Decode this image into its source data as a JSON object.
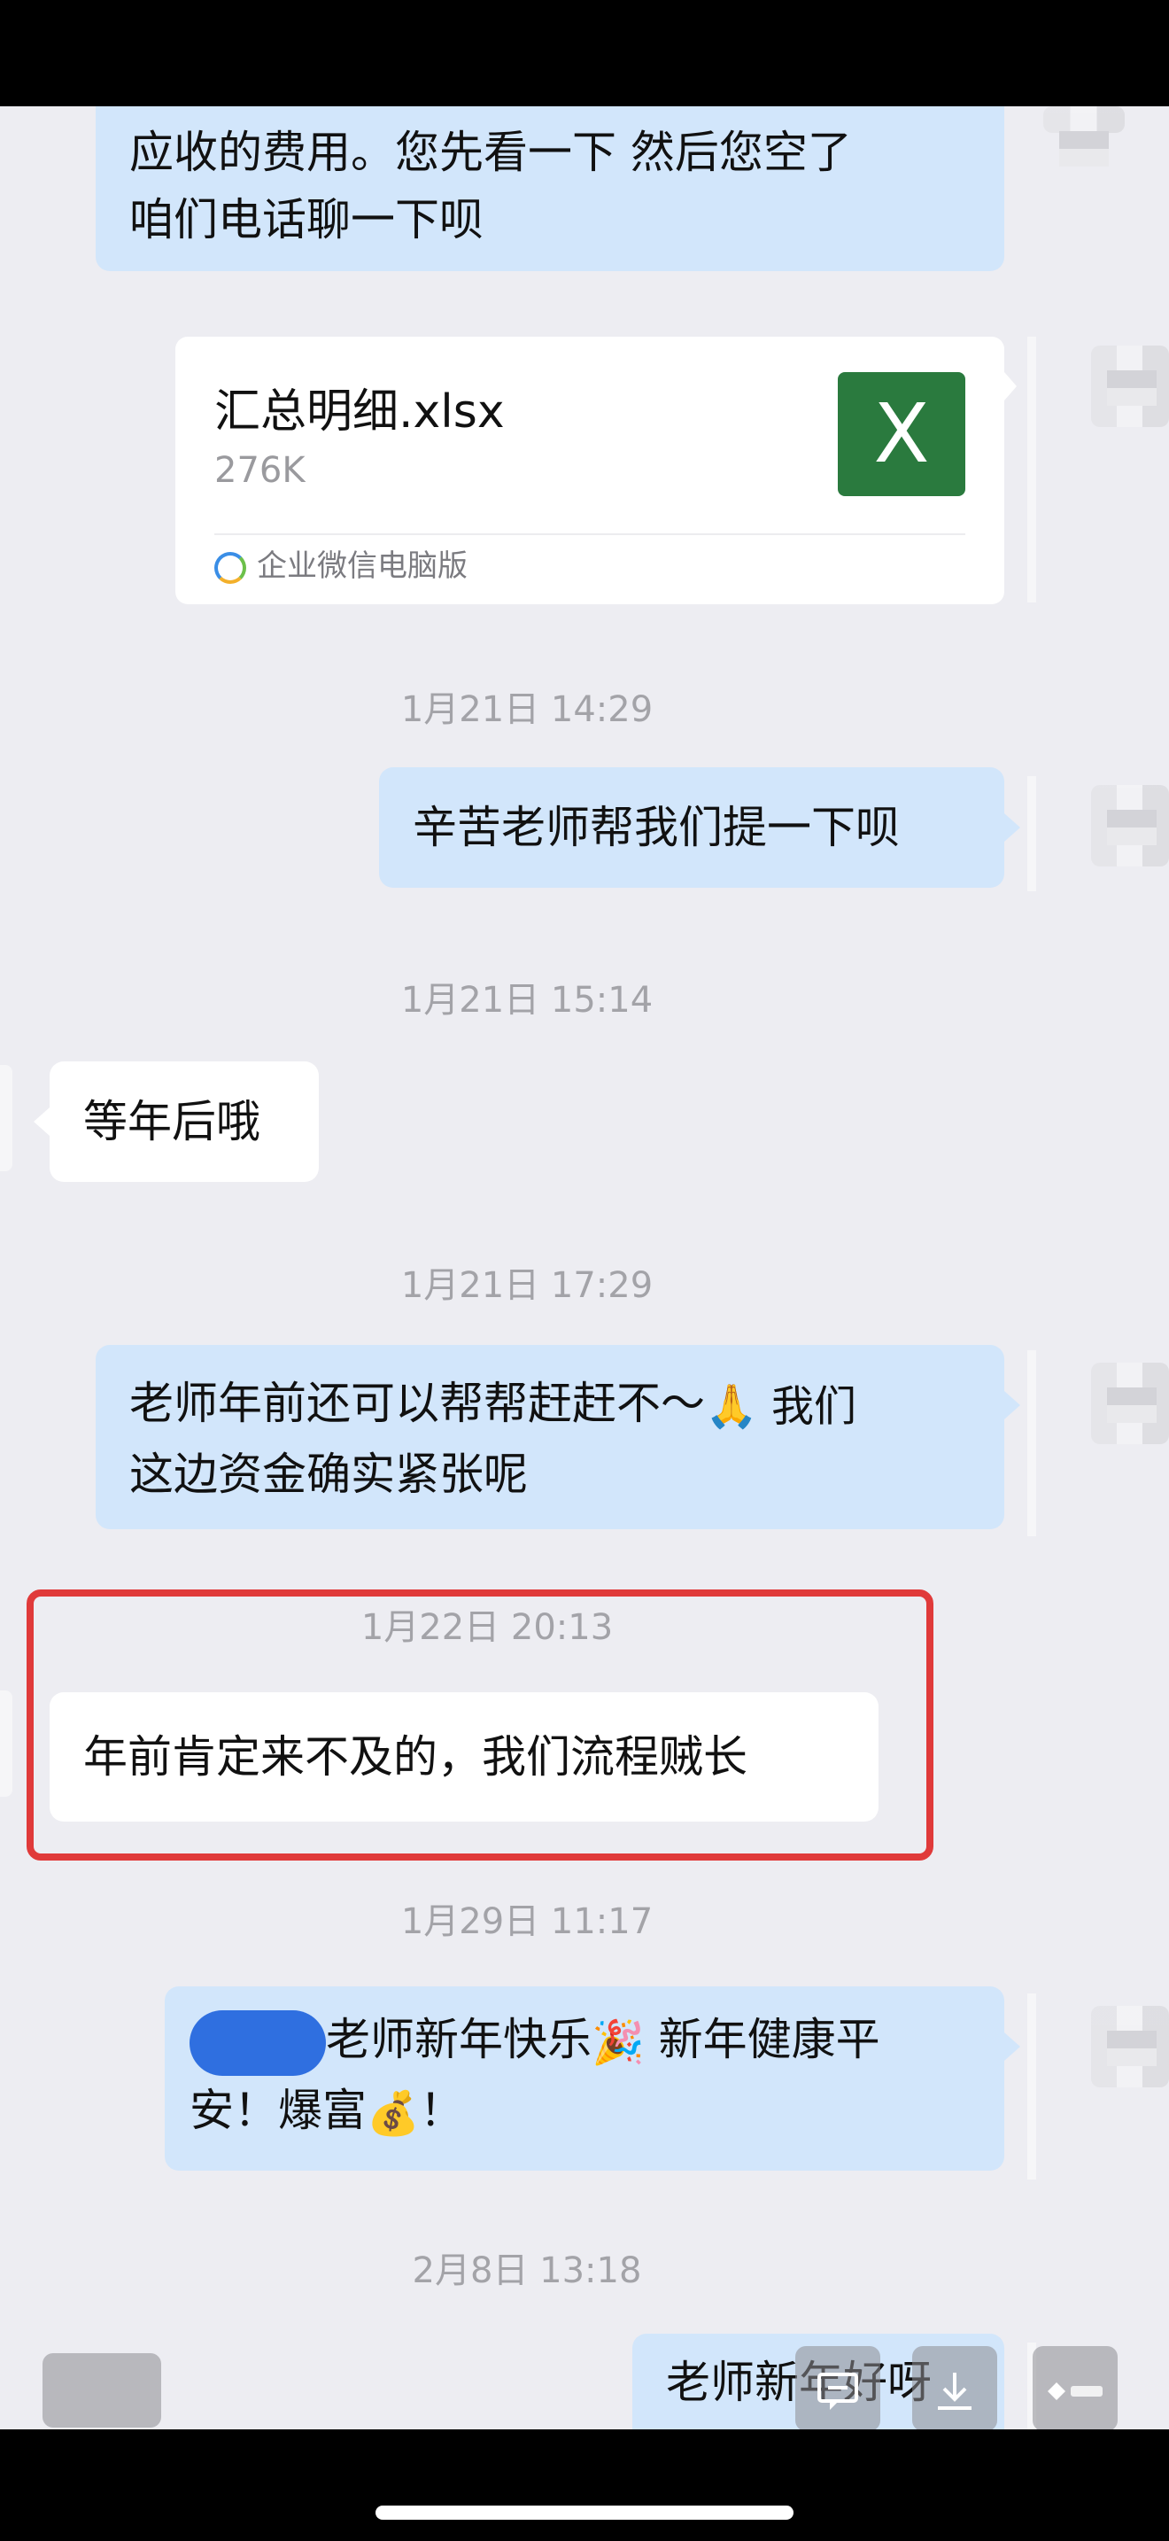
{
  "chat": {
    "messages": [
      {
        "kind": "out",
        "lines": [
          "应收的费用。您先看一下 然后您空了",
          "咱们电话聊一下呗"
        ]
      },
      {
        "kind": "file",
        "file_name": "汇总明细.xlsx",
        "file_size": "276K",
        "source": "企业微信电脑版",
        "icon_letter": "X"
      },
      {
        "kind": "time",
        "text": "1月21日 14:29"
      },
      {
        "kind": "out",
        "text": "辛苦老师帮我们提一下呗"
      },
      {
        "kind": "time",
        "text": "1月21日 15:14"
      },
      {
        "kind": "in",
        "text": "等年后哦"
      },
      {
        "kind": "time",
        "text": "1月21日 17:29"
      },
      {
        "kind": "out",
        "lines": [
          "老师年前还可以帮帮赶赶不～",
          "🙏 我们",
          "这边资金确实紧张呢"
        ]
      },
      {
        "kind": "time",
        "text": "1月22日 20:13"
      },
      {
        "kind": "in",
        "text": "年前肯定来不及的，我们流程贼长"
      },
      {
        "kind": "time",
        "text": "1月29日 11:17"
      },
      {
        "kind": "out",
        "lines": [
          "老师新年快乐",
          "🎉",
          " 新年健康平",
          "安！爆富",
          "💰",
          "！"
        ]
      },
      {
        "kind": "time",
        "text": "2月8日 13:18"
      },
      {
        "kind": "out",
        "text": "老师新年好呀"
      }
    ]
  },
  "colors": {
    "outgoing_bubble": "#d2e6fb",
    "incoming_bubble": "#ffffff",
    "background": "#ededf2",
    "highlight_border": "#e03a3a",
    "excel_green": "#2a7a3e"
  },
  "floating_buttons": {
    "comment_icon": "comment-icon",
    "download_icon": "download-icon",
    "logo_icon": "logo-icon"
  }
}
